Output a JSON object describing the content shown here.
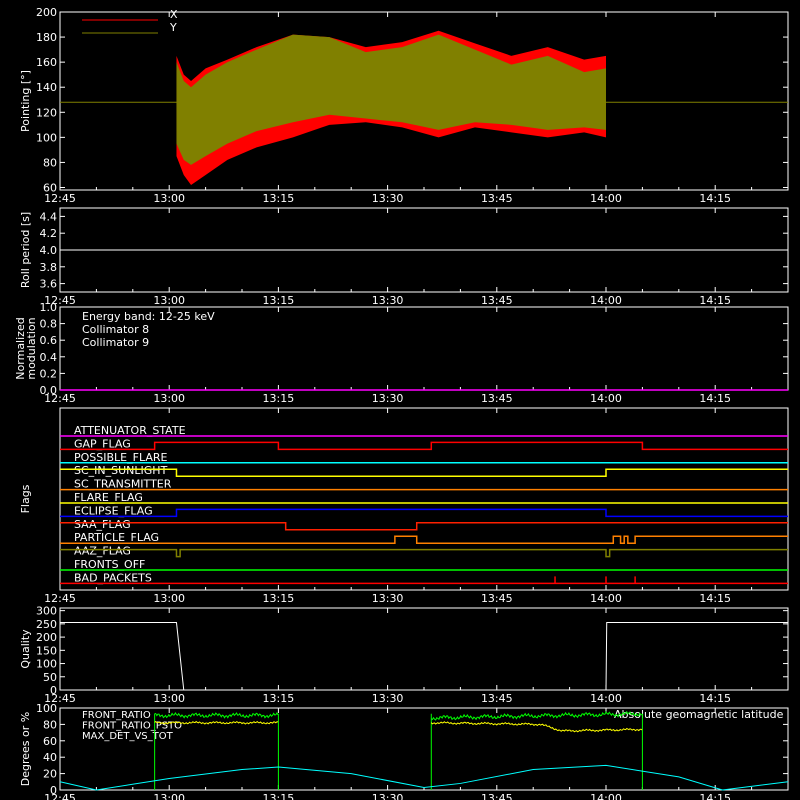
{
  "chart_data": [
    {
      "id": "pointing",
      "type": "area",
      "ylabel": "Pointing [°]",
      "ylim": [
        58,
        200
      ],
      "yticks": [
        60,
        80,
        100,
        120,
        140,
        160,
        180,
        200
      ],
      "xlim": [
        "12:45",
        "14:25"
      ],
      "xticks": [
        "12:45",
        "13:00",
        "13:15",
        "13:30",
        "13:45",
        "14:00",
        "14:15"
      ],
      "legend": [
        {
          "name": "X",
          "color": "#ff0000"
        },
        {
          "name": "Y",
          "color": "#808000"
        }
      ],
      "baseline": 128,
      "x_envelope": {
        "x": [
          "13:01",
          "13:02",
          "13:03",
          "13:05",
          "13:08",
          "13:12",
          "13:17",
          "13:22",
          "13:27",
          "13:32",
          "13:37",
          "13:42",
          "13:47",
          "13:52",
          "13:57",
          "14:00"
        ],
        "upper": [
          165,
          150,
          145,
          155,
          162,
          172,
          182,
          180,
          172,
          176,
          185,
          175,
          165,
          172,
          162,
          165
        ],
        "lower": [
          85,
          70,
          62,
          70,
          82,
          92,
          100,
          110,
          112,
          108,
          100,
          108,
          104,
          100,
          104,
          100
        ]
      },
      "y_envelope": {
        "x": [
          "13:01",
          "13:02",
          "13:03",
          "13:05",
          "13:08",
          "13:12",
          "13:17",
          "13:22",
          "13:27",
          "13:32",
          "13:37",
          "13:42",
          "13:47",
          "13:52",
          "13:57",
          "14:00"
        ],
        "upper": [
          160,
          145,
          140,
          150,
          160,
          170,
          182,
          180,
          168,
          172,
          182,
          170,
          158,
          165,
          152,
          155
        ],
        "lower": [
          95,
          82,
          78,
          85,
          95,
          105,
          112,
          118,
          115,
          112,
          106,
          112,
          110,
          106,
          108,
          106
        ]
      }
    },
    {
      "id": "roll",
      "type": "line",
      "ylabel": "Roll period [s]",
      "ylim": [
        3.5,
        4.5
      ],
      "yticks": [
        3.6,
        3.8,
        4.0,
        4.2,
        4.4
      ],
      "series": [
        {
          "values_x": [
            "12:45",
            "14:25"
          ],
          "values_y": [
            4.0,
            4.0
          ],
          "color": "#ffffff"
        }
      ]
    },
    {
      "id": "modulation",
      "type": "line",
      "ylabel": "Normalized modulation",
      "ylim": [
        0.0,
        1.0
      ],
      "yticks": [
        0.0,
        0.2,
        0.4,
        0.6,
        0.8,
        1.0
      ],
      "annotations": [
        {
          "text": "Energy band: 12-25 keV",
          "color": "#ffffff"
        },
        {
          "text": "Collimator 8",
          "color": "#00ffff"
        },
        {
          "text": "Collimator 9",
          "color": "#ff00ff"
        }
      ],
      "series": [
        {
          "values_x": [
            "12:45",
            "14:25"
          ],
          "values_y": [
            0.0,
            0.0
          ],
          "color": "#ff00ff"
        }
      ]
    },
    {
      "id": "flags",
      "type": "line",
      "ylabel": "Flags",
      "flags": [
        {
          "name": "ATTENUATOR_STATE",
          "color": "#ff00ff",
          "steps": [
            [
              "12:45",
              0
            ]
          ]
        },
        {
          "name": "GAP_FLAG",
          "color": "#ff0000",
          "steps": [
            [
              "12:45",
              0
            ],
            [
              "12:58",
              -1
            ],
            [
              "13:15",
              0
            ],
            [
              "13:36",
              -1
            ],
            [
              "14:05",
              0
            ]
          ]
        },
        {
          "name": "POSSIBLE_FLARE",
          "color": "#00ffff",
          "steps": [
            [
              "12:45",
              0
            ]
          ]
        },
        {
          "name": "SC_IN_SUNLIGHT",
          "color": "#ffff00",
          "steps": [
            [
              "12:45",
              -1
            ],
            [
              "13:01",
              0
            ],
            [
              "14:00",
              -1
            ]
          ]
        },
        {
          "name": "SC_TRANSMITTER",
          "color": "#ff8000",
          "steps": [
            [
              "12:45",
              0
            ]
          ]
        },
        {
          "name": "FLARE_FLAG",
          "color": "#ffff00",
          "steps": [
            [
              "12:45",
              0
            ]
          ]
        },
        {
          "name": "ECLIPSE_FLAG",
          "color": "#0000ff",
          "steps": [
            [
              "12:45",
              0
            ],
            [
              "13:01",
              -1
            ],
            [
              "14:00",
              0
            ]
          ]
        },
        {
          "name": "SAA_FLAG",
          "color": "#ff2000",
          "steps": [
            [
              "12:45",
              -1
            ],
            [
              "13:16",
              0
            ],
            [
              "13:34",
              -1
            ]
          ]
        },
        {
          "name": "PARTICLE_FLAG",
          "color": "#ff8000",
          "steps": [
            [
              "12:45",
              0
            ],
            [
              "13:31",
              -1
            ],
            [
              "13:34",
              0
            ],
            [
              "14:01",
              -1
            ],
            [
              "14:02",
              0
            ],
            [
              "14:02.5",
              -1
            ],
            [
              "14:03",
              0
            ],
            [
              "14:04",
              -1
            ]
          ]
        },
        {
          "name": "AAZ_FLAG",
          "color": "#808000",
          "steps": [
            [
              "12:45",
              -1
            ],
            [
              "13:01",
              0
            ],
            [
              "13:01.5",
              -1
            ],
            [
              "14:00",
              0
            ],
            [
              "14:00.5",
              -1
            ]
          ]
        },
        {
          "name": "FRONTS_OFF",
          "color": "#00ff00",
          "steps": [
            [
              "12:45",
              0
            ]
          ]
        },
        {
          "name": "BAD_PACKETS",
          "color": "#ff0000",
          "steps": [
            [
              "12:45",
              0
            ]
          ],
          "spikes": [
            "13:53",
            "14:00",
            "14:04"
          ]
        }
      ]
    },
    {
      "id": "quality",
      "type": "line",
      "ylabel": "Quality",
      "ylim": [
        0,
        310
      ],
      "yticks": [
        0,
        50,
        100,
        150,
        200,
        250,
        300
      ],
      "series": [
        {
          "values_x": [
            "12:45",
            "13:01",
            "13:02",
            "14:00",
            "14:00.1",
            "14:25"
          ],
          "values_y": [
            255,
            255,
            0,
            0,
            255,
            255
          ],
          "color": "#ffffff"
        }
      ]
    },
    {
      "id": "ratios",
      "type": "line",
      "ylabel": "Degrees or %",
      "ylim": [
        0,
        100
      ],
      "yticks": [
        0,
        20,
        40,
        60,
        80,
        100
      ],
      "legend": [
        {
          "name": "FRONT_RATIO",
          "color": "#ffff00"
        },
        {
          "name": "FRONT_RATIO_PSTO",
          "color": "#00ff00"
        },
        {
          "name": "MAX_DET_VS_TOT",
          "color": "#ff8000"
        }
      ],
      "annotation": {
        "text": "Absolute geomagnetic latitude",
        "color": "#00ffff"
      },
      "series": [
        {
          "name": "FRONT_RATIO",
          "color": "#ffff00",
          "segments": [
            {
              "x": [
                "12:58",
                "13:15"
              ],
              "y": [
                82,
                82
              ]
            },
            {
              "x": [
                "13:36",
                "13:51",
                "13:54",
                "14:05"
              ],
              "y": [
                82,
                80,
                72,
                74
              ]
            }
          ]
        },
        {
          "name": "FRONT_RATIO_PSTO",
          "color": "#00ff00",
          "segments": [
            {
              "x": [
                "12:58",
                "13:15"
              ],
              "y": [
                91,
                91
              ]
            },
            {
              "x": [
                "13:36",
                "14:05"
              ],
              "y": [
                88,
                93
              ]
            }
          ]
        },
        {
          "name": "Absolute geomagnetic latitude",
          "color": "#00ffff",
          "x": [
            "12:45",
            "12:50",
            "13:00",
            "13:10",
            "13:15",
            "13:25",
            "13:35",
            "13:40",
            "13:50",
            "14:00",
            "14:10",
            "14:16",
            "14:25"
          ],
          "y": [
            10,
            0,
            14,
            25,
            28,
            20,
            3,
            8,
            25,
            30,
            16,
            0,
            10
          ]
        }
      ]
    }
  ]
}
